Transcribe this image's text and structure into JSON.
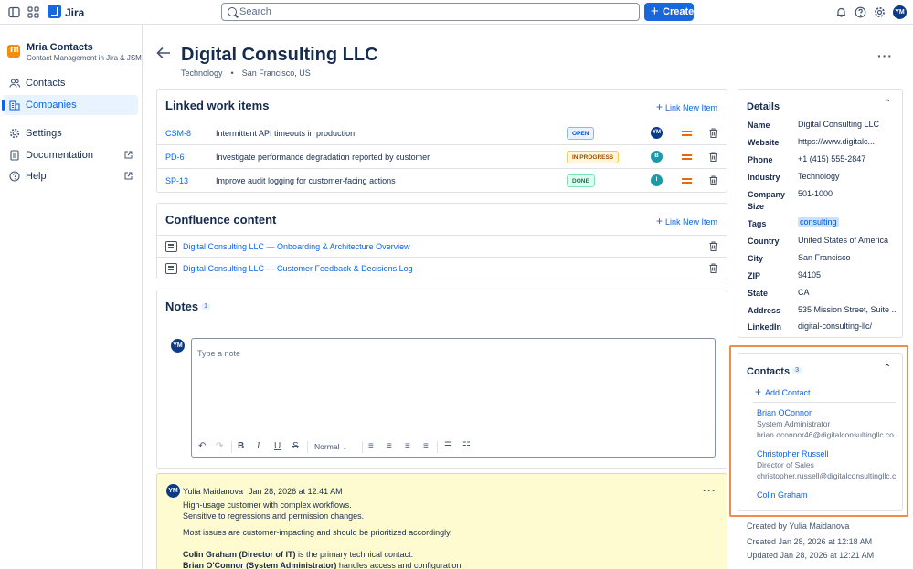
{
  "topbar": {
    "app_name": "Jira",
    "search_placeholder": "Search",
    "create_label": "Create",
    "user_initials": "YM"
  },
  "sidebar": {
    "app_title": "Mria Contacts",
    "app_subtitle": "Contact Management in Jira & JSM",
    "items": [
      {
        "label": "Contacts",
        "icon": "people-icon"
      },
      {
        "label": "Companies",
        "icon": "building-icon",
        "active": true
      },
      {
        "label": "Settings",
        "icon": "gear-icon"
      },
      {
        "label": "Documentation",
        "icon": "document-icon",
        "external": true
      },
      {
        "label": "Help",
        "icon": "help-icon",
        "external": true
      }
    ]
  },
  "company": {
    "name": "Digital Consulting LLC",
    "industry": "Technology",
    "location": "San Francisco, US"
  },
  "linked_work_items": {
    "title": "Linked work items",
    "action": "Link New Item",
    "items": [
      {
        "key": "CSM-8",
        "summary": "Intermittent API timeouts in production",
        "status": "OPEN",
        "assignee": "YM",
        "assignee_color": "#0b3a87"
      },
      {
        "key": "PD-6",
        "summary": "Investigate performance degradation reported by customer",
        "status": "IN PROGRESS",
        "assignee": "B",
        "assignee_color": "#1d9aaa"
      },
      {
        "key": "SP-13",
        "summary": "Improve audit logging for customer-facing actions",
        "status": "DONE",
        "assignee": "I",
        "assignee_color": "#1d9aaa"
      }
    ]
  },
  "confluence": {
    "title": "Confluence content",
    "action": "Link New Item",
    "items": [
      "Digital Consulting LLC — Onboarding & Architecture Overview",
      "Digital Consulting LLC — Customer Feedback & Decisions Log"
    ]
  },
  "notes": {
    "title": "Notes",
    "count": "1",
    "editor_placeholder": "Type a note",
    "author_initials": "YM",
    "text_style": "Normal",
    "entry": {
      "author": "Yulia Maidanova",
      "timestamp": "Jan 28, 2026 at 12:41 AM",
      "line1": "High-usage customer with complex workflows.",
      "line2": "Sensitive to regressions and permission changes.",
      "line3": "Most issues are customer-impacting and should be prioritized accordingly.",
      "line4_bold": "Colin Graham (Director of IT)",
      "line4_rest": " is the primary technical contact.",
      "line5_bold": "Brian O'Connor (System Administrator)",
      "line5_rest": " handles access and configuration."
    }
  },
  "details": {
    "title": "Details",
    "fields": [
      {
        "k": "Name",
        "v": "Digital Consulting LLC"
      },
      {
        "k": "Website",
        "v": "https://www.digitalc..."
      },
      {
        "k": "Phone",
        "v": "+1 (415) 555-2847"
      },
      {
        "k": "Industry",
        "v": "Technology"
      },
      {
        "k": "Company Size",
        "v": "501-1000"
      },
      {
        "k": "Tags",
        "v": "consulting"
      },
      {
        "k": "Country",
        "v": "United States of America"
      },
      {
        "k": "City",
        "v": "San Francisco"
      },
      {
        "k": "ZIP",
        "v": "94105"
      },
      {
        "k": "State",
        "v": "CA"
      },
      {
        "k": "Address",
        "v": "535 Mission Street, Suite ..."
      },
      {
        "k": "LinkedIn",
        "v": "digital-consulting-llc/"
      }
    ]
  },
  "contacts": {
    "title": "Contacts",
    "count": "3",
    "add_label": "Add Contact",
    "items": [
      {
        "name": "Brian OConnor",
        "role": "System Administrator",
        "email": "brian.oconnor46@digitalconsultingllc.co"
      },
      {
        "name": "Christopher Russell",
        "role": "Director of Sales",
        "email": "christopher.russell@digitalconsultingllc.c"
      },
      {
        "name": "Colin Graham",
        "role": "",
        "email": ""
      }
    ]
  },
  "meta": {
    "created_by": "Created by Yulia Maidanova",
    "created": "Created Jan 28, 2026 at 12:18 AM",
    "updated": "Updated Jan 28, 2026 at 12:21 AM"
  }
}
